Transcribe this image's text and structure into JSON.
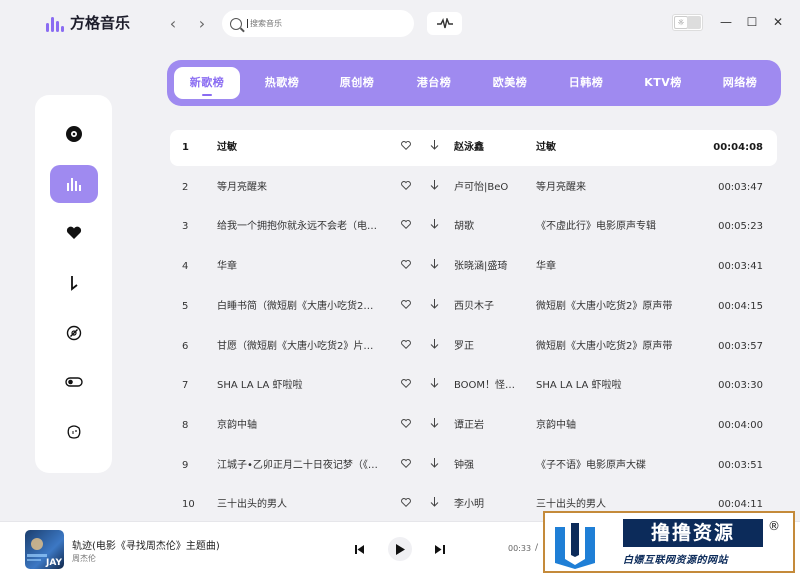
{
  "app": {
    "title": "方格音乐"
  },
  "search": {
    "placeholder": "搜索音乐"
  },
  "tabs": [
    {
      "label": "新歌榜",
      "active": true
    },
    {
      "label": "热歌榜"
    },
    {
      "label": "原创榜"
    },
    {
      "label": "港台榜"
    },
    {
      "label": "欧美榜"
    },
    {
      "label": "日韩榜"
    },
    {
      "label": "KTV榜"
    },
    {
      "label": "网络榜"
    }
  ],
  "sidebar": {
    "items": [
      {
        "icon": "disc-icon"
      },
      {
        "icon": "chart-bars-icon",
        "active": true
      },
      {
        "icon": "heart-icon"
      },
      {
        "icon": "download-icon"
      },
      {
        "icon": "music-note-circle-icon"
      },
      {
        "icon": "toggle-icon"
      },
      {
        "icon": "face-icon"
      }
    ]
  },
  "songs": [
    {
      "index": "1",
      "title": "过敏",
      "artist": "赵泳鑫",
      "album": "过敏",
      "duration": "00:04:08"
    },
    {
      "index": "2",
      "title": "等月亮醒来",
      "artist": "卢可怡|BeO",
      "album": "等月亮醒来",
      "duration": "00:03:47"
    },
    {
      "index": "3",
      "title": "给我一个拥抱你就永远不会老（电…",
      "artist": "胡歌",
      "album": "《不虚此行》电影原声专辑",
      "duration": "00:05:23"
    },
    {
      "index": "4",
      "title": "华章",
      "artist": "张晓涵|盛琦",
      "album": "华章",
      "duration": "00:03:41"
    },
    {
      "index": "5",
      "title": "白睡书简（微短剧《大唐小吃货2…",
      "artist": "西贝木子",
      "album": "微短剧《大唐小吃货2》原声带",
      "duration": "00:04:15"
    },
    {
      "index": "6",
      "title": "甘愿（微短剧《大唐小吃货2》片…",
      "artist": "罗正",
      "album": "微短剧《大唐小吃货2》原声带",
      "duration": "00:03:57"
    },
    {
      "index": "7",
      "title": "SHA LA LA 虾啦啦",
      "artist": "BOOM！怪…",
      "album": "SHA LA LA 虾啦啦",
      "duration": "00:03:30"
    },
    {
      "index": "8",
      "title": "京韵中轴",
      "artist": "谭正岩",
      "album": "京韵中轴",
      "duration": "00:04:00"
    },
    {
      "index": "9",
      "title": "江城子•乙卯正月二十日夜记梦（《…",
      "artist": "钟强",
      "album": "《子不语》电影原声大碟",
      "duration": "00:03:51"
    },
    {
      "index": "10",
      "title": "三十出头的男人",
      "artist": "李小明",
      "album": "三十出头的男人",
      "duration": "00:04:11"
    }
  ],
  "player": {
    "title": "轨迹(电影《寻找周杰伦》主题曲)",
    "artist": "周杰伦",
    "cover_text": "JAY",
    "current_time": "00:33",
    "separator": "/"
  },
  "watermark": {
    "title": "撸撸资源",
    "registered": "®",
    "subtitle": "白嫖互联网资源的网站"
  },
  "colors": {
    "accent": "#9f8af0",
    "accent_dark": "#8a6cf2",
    "background": "#f1f1f4"
  }
}
